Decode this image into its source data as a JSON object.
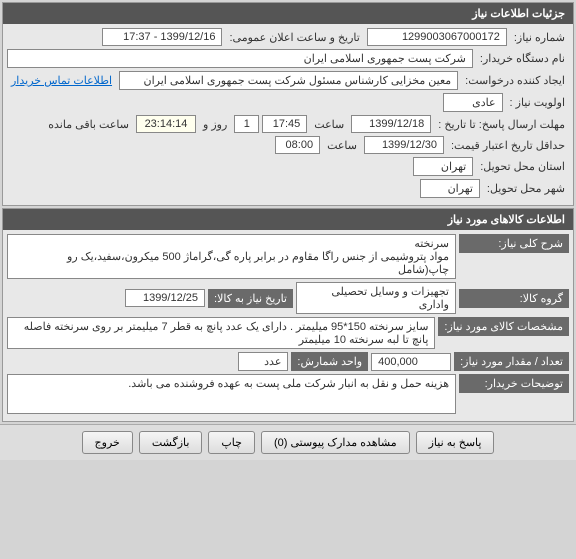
{
  "panel1": {
    "title": "جزئیات اطلاعات نیاز",
    "need_number_label": "شماره نیاز:",
    "need_number": "1299003067000172",
    "announce_label": "تاریخ و ساعت اعلان عمومی:",
    "announce_value": "1399/12/16 - 17:37",
    "buyer_label": "نام دستگاه خریدار:",
    "buyer_value": "شرکت پست جمهوری اسلامی ایران",
    "creator_label": "ایجاد کننده درخواست:",
    "creator_value": "معین مخزایی  کارشناس مسئول   شرکت پست جمهوری اسلامی ایران",
    "contact_link": "اطلاعات تماس خریدار",
    "priority_label": "اولویت نیاز :",
    "priority_value": "عادی",
    "deadline_label": "مهلت ارسال پاسخ:  تا تاریخ :",
    "deadline_date": "1399/12/18",
    "deadline_time_label": "ساعت",
    "deadline_time": "17:45",
    "deadline_days": "1",
    "deadline_days_label": "روز و",
    "deadline_countdown": "23:14:14",
    "deadline_remain_label": "ساعت باقی مانده",
    "credit_label": "حداقل تاریخ اعتبار قیمت:",
    "credit_date": "1399/12/30",
    "credit_time_label": "ساعت",
    "credit_time": "08:00",
    "province_label": "استان محل تحویل:",
    "province_value": "تهران",
    "city_label": "شهر محل تحویل:",
    "city_value": "تهران"
  },
  "panel2": {
    "title": "اطلاعات کالاهای مورد نیاز",
    "desc_label": "شرح کلی نیاز:",
    "desc_value": "سرنخته\nمواد پتروشیمی از جنس راگا مقاوم در برابر پاره گی،گراماژ 500 میکرون،سفید،یک رو چاپ(شامل",
    "group_label": "گروه کالا:",
    "group_value": "تجهیزات و وسایل تحصیلی واداری",
    "need_date_label": "تاریخ نیاز به کالا:",
    "need_date": "1399/12/25",
    "spec_label": "مشخصات کالای مورد نیاز:",
    "spec_value": "سایز سرنخته 150*95 میلیمتر . دارای یک عدد پانچ به قطر 7 میلیمتر بر روی سرنخته فاصله پانچ تا لبه سرنخته 10 میلیمتر",
    "qty_label": "تعداد / مقدار مورد نیاز:",
    "qty_value": "400,000",
    "unit_label": "واحد شمارش:",
    "unit_value": "عدد",
    "notes_label": "توضیحات خریدار:",
    "notes_value": "هزینه حمل و نقل به انبار شرکت ملی پست به عهده فروشنده می باشد."
  },
  "buttons": {
    "respond": "پاسخ به نیاز",
    "attachments": "مشاهده مدارک پیوستی (0)",
    "print": "چاپ",
    "back": "بازگشت",
    "exit": "خروج"
  }
}
